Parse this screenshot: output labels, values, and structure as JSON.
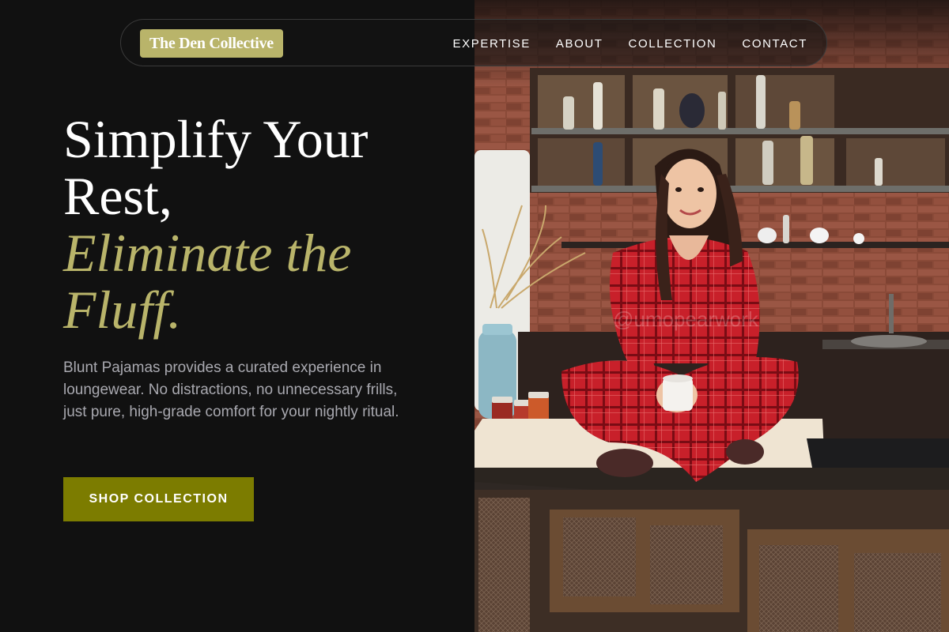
{
  "nav": {
    "logo": "The Den Collective",
    "links": [
      "EXPERTISE",
      "ABOUT",
      "COLLECTION",
      "CONTACT"
    ]
  },
  "hero": {
    "headline_line1": "Simplify Your",
    "headline_line2": "Rest,",
    "headline_accent_line1": "Eliminate the",
    "headline_accent_line2": "Fluff.",
    "description": "Blunt Pajamas provides a curated experience in loungewear. No distractions, no unnecessary frills, just pure, high-grade comfort for your nightly ritual.",
    "cta_label": "SHOP COLLECTION"
  },
  "photo": {
    "watermark": "@umopearwork",
    "subject": "woman in red plaid pajamas sitting on a kitchen counter holding a mug"
  },
  "colors": {
    "background": "#111111",
    "accent_olive": "#b9b46a",
    "button": "#7c7c00",
    "body_text": "#a9a9b0",
    "pajama_red": "#c8202a"
  }
}
